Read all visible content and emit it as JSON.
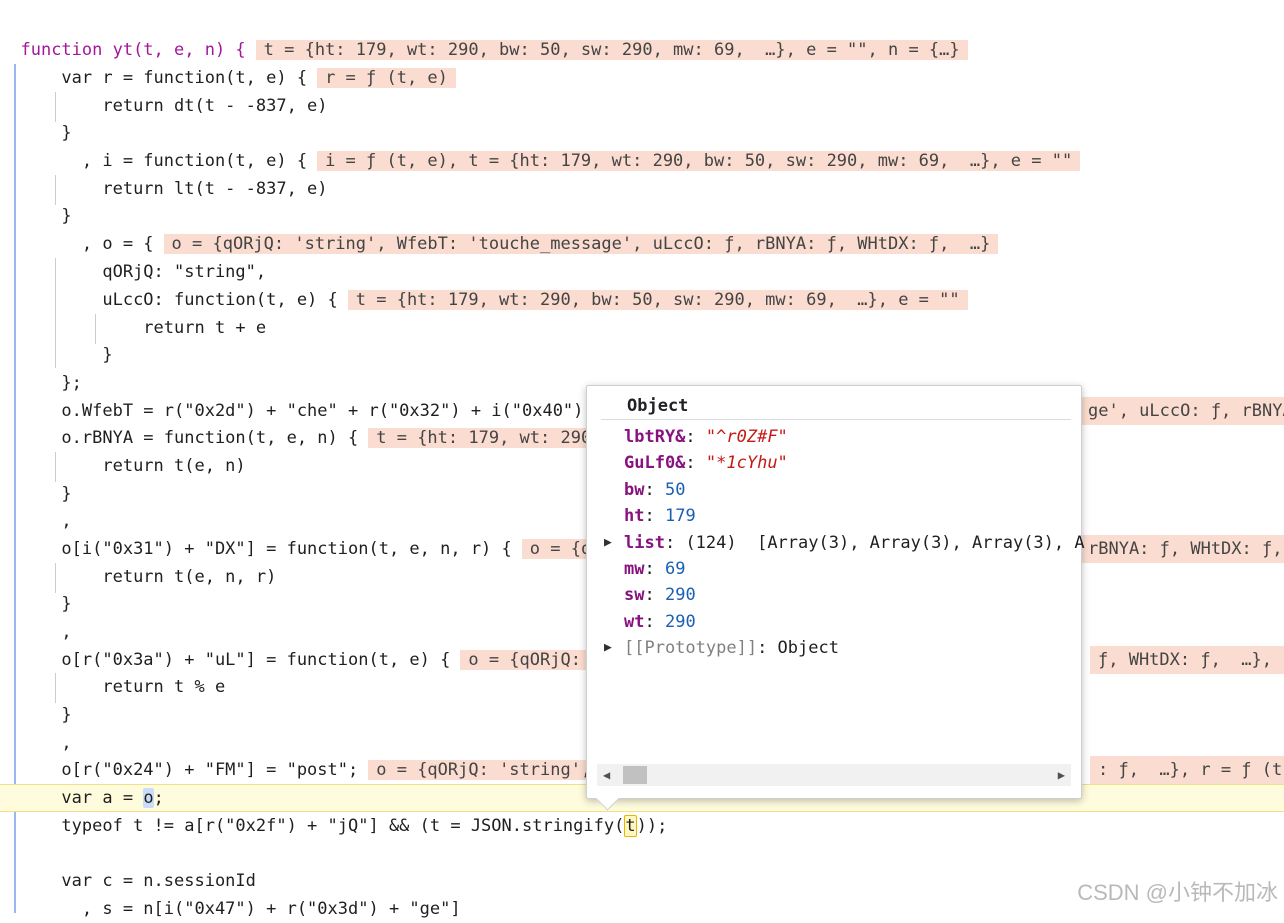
{
  "code": {
    "l0": "function yt(t, e, n) {",
    "l0_inline": "t = {ht: 179, wt: 290, bw: 50, sw: 290, mw: 69,  …}, e = \"\", n = {…}",
    "l1": "    var r = function(t, e) {",
    "l1_inline": "r = ƒ (t, e)",
    "l2": "        return dt(t - -837, e)",
    "l3": "    }",
    "l4": "      , i = function(t, e) {",
    "l4_inline": "i = ƒ (t, e), t = {ht: 179, wt: 290, bw: 50, sw: 290, mw: 69,  …}, e = \"\"",
    "l5": "        return lt(t - -837, e)",
    "l6": "    }",
    "l7": "      , o = {",
    "l7_inline": "o = {qORjQ: 'string', WfebT: 'touche_message', uLccO: ƒ, rBNYA: ƒ, WHtDX: ƒ,  …}",
    "l8": "        qORjQ: \"string\",",
    "l9": "        uLccO: function(t, e) {",
    "l9_inline": "t = {ht: 179, wt: 290, bw: 50, sw: 290, mw: 69,  …}, e = \"\"",
    "l10": "            return t + e",
    "l11": "        }",
    "l12": "    };",
    "l13": "    o.WfebT = r(\"0x2d\") + \"che\" + r(\"0x32\") + i(\"0x40\") + ",
    "l13_tail": "ge', uLccO: ƒ, rBNYA",
    "l14": "    o.rBNYA = function(t, e, n) {",
    "l14_inline": "t = {ht: 179, wt: 290,",
    "l15": "        return t(e, n)",
    "l16": "    }",
    "l17": "    ,",
    "l18": "    o[i(\"0x31\") + \"DX\"] = function(t, e, n, r) {",
    "l18_inline": "o = {qO",
    "l18_tail": "rBNYA: ƒ, WHtDX: ƒ,",
    "l19": "        return t(e, n, r)",
    "l20": "    }",
    "l21": "    ,",
    "l22": "    o[r(\"0x3a\") + \"uL\"] = function(t, e) {",
    "l22_inline": "o = {qORjQ: '",
    "l22_tail": "ƒ, WHtDX: ƒ,  …}, r",
    "l23": "        return t % e",
    "l24": "    }",
    "l25": "    ,",
    "l26": "    o[r(\"0x24\") + \"FM\"] = \"post\";",
    "l26_inline": "o = {qORjQ: 'string',",
    "l26_tail": ": ƒ,  …}, r = ƒ (t,",
    "l27_pre": "    var a = ",
    "l27_o": "o",
    "l27_post": ";",
    "l28_pre": "    typeof t != a[r(\"0x2f\") + \"jQ\"] && (t = JSON.stringify(",
    "l28_t": "t",
    "l28_post": "));",
    "l29": "",
    "l30": "    var c = n.sessionId",
    "l31": "      , s = n[i(\"0x47\") + r(\"0x3d\") + \"ge\"]"
  },
  "popover": {
    "title": "Object",
    "props": [
      {
        "key": "lbtRY&",
        "sep": ": ",
        "value": "\"^r0Z#F\"",
        "kind": "string"
      },
      {
        "key": "GuLf0&",
        "sep": ": ",
        "value": "\"*1cYhu\"",
        "kind": "string"
      },
      {
        "key": "bw",
        "sep": ": ",
        "value": "50",
        "kind": "number"
      },
      {
        "key": "ht",
        "sep": ": ",
        "value": "179",
        "kind": "number"
      },
      {
        "key": "list",
        "sep": ": ",
        "value": "(124)  [Array(3), Array(3), Array(3), A",
        "kind": "array"
      },
      {
        "key": "mw",
        "sep": ": ",
        "value": "69",
        "kind": "number"
      },
      {
        "key": "sw",
        "sep": ": ",
        "value": "290",
        "kind": "number"
      },
      {
        "key": "wt",
        "sep": ": ",
        "value": "290",
        "kind": "number"
      },
      {
        "key": "[[Prototype]]",
        "sep": ": ",
        "value": "Object",
        "kind": "proto"
      }
    ]
  },
  "watermark": "CSDN @小钟不加冰",
  "icons": {
    "expand": "triangle-right-icon",
    "scroll_left": "scroll-left-icon",
    "scroll_right": "scroll-right-icon"
  }
}
